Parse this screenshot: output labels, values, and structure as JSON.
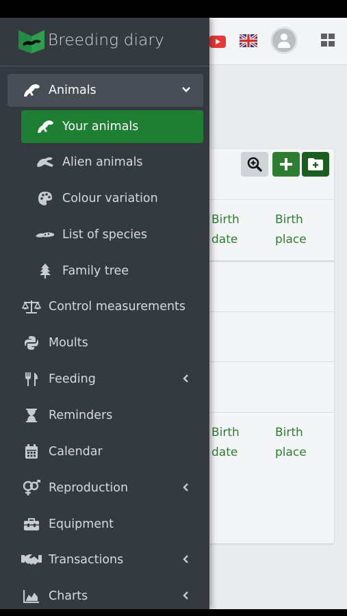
{
  "brand": {
    "title": "Breeding diary"
  },
  "table": {
    "col1_header_line1": "Birth",
    "col1_header_line2": "date",
    "col2_header_line1": "Birth",
    "col2_header_line2": "place"
  },
  "sidebar": {
    "items": [
      {
        "label": "Animals",
        "icon": "lizard-icon",
        "expanded": true
      },
      {
        "label": "Your animals",
        "icon": "lizard-icon",
        "active": true
      },
      {
        "label": "Alien animals",
        "icon": "alien-lizard-icon"
      },
      {
        "label": "Colour variation",
        "icon": "palette-icon"
      },
      {
        "label": "List of species",
        "icon": "gecko-icon"
      },
      {
        "label": "Family tree",
        "icon": "tree-icon"
      },
      {
        "label": "Control measurements",
        "icon": "balance-scale-icon"
      },
      {
        "label": "Moults",
        "icon": "python-icon"
      },
      {
        "label": "Feeding",
        "icon": "utensils-icon",
        "has_children": true
      },
      {
        "label": "Reminders",
        "icon": "hourglass-icon"
      },
      {
        "label": "Calendar",
        "icon": "calendar-icon"
      },
      {
        "label": "Reproduction",
        "icon": "venus-mars-icon",
        "has_children": true
      },
      {
        "label": "Equipment",
        "icon": "toolbox-icon"
      },
      {
        "label": "Transactions",
        "icon": "handshake-icon",
        "has_children": true
      },
      {
        "label": "Charts",
        "icon": "chart-area-icon",
        "has_children": true
      }
    ]
  },
  "colors": {
    "sidebar_bg": "#343a40",
    "active_bg": "#1e7e34",
    "accent_green": "#2e7d32",
    "brand_green": "#28a745"
  }
}
